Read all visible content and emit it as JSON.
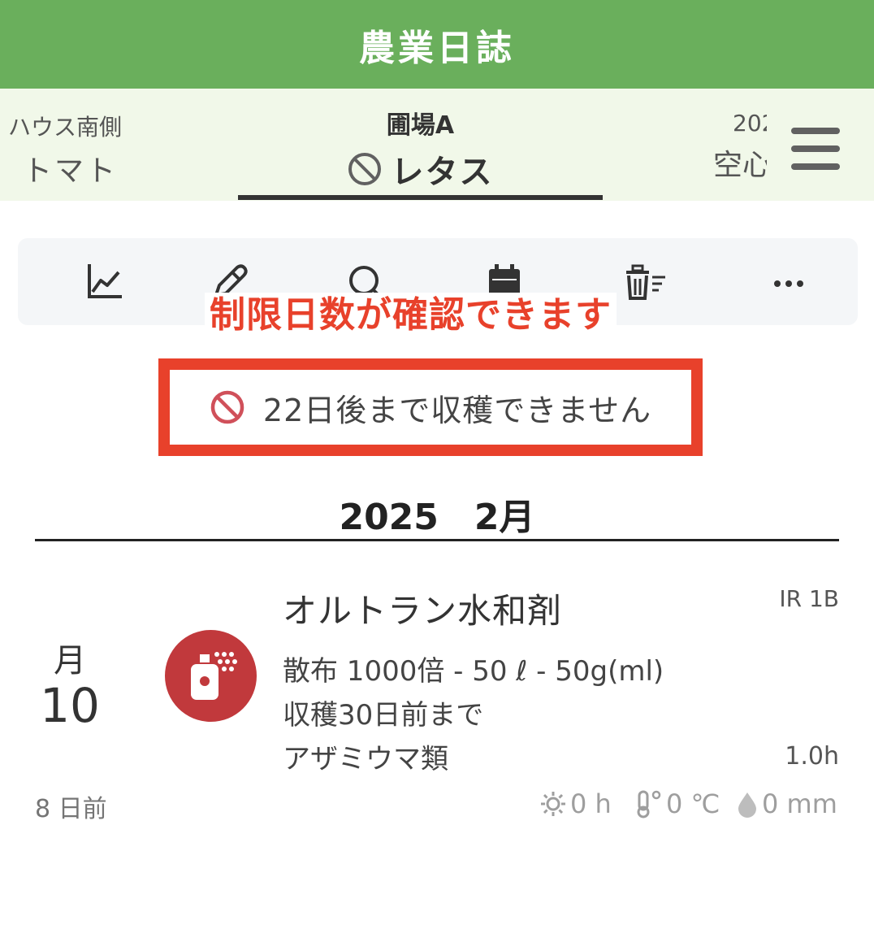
{
  "app": {
    "title": "農業日誌"
  },
  "fields": {
    "left": {
      "location": "ハウス南側",
      "crop": "トマト"
    },
    "center": {
      "location": "圃場A",
      "crop": "レタス"
    },
    "right": {
      "location": "202",
      "crop": "空心"
    }
  },
  "toolbar": {
    "icons": [
      "chart-line-icon",
      "pen-icon",
      "search-icon",
      "calendar-icon",
      "trash-list-icon",
      "more-icon"
    ]
  },
  "callout": {
    "text": "制限日数が確認できます"
  },
  "warning": {
    "text": "22日後まで収穫できません",
    "icon": "prohibited-icon"
  },
  "month": {
    "heading": "2025　2月"
  },
  "entry": {
    "weekday": "月",
    "day": "10",
    "icon": "spray-icon",
    "title": "オルトラン水和剤",
    "code": "IR 1B",
    "detail1": "散布 1000倍 - 50 ℓ  - 50g(ml)",
    "detail2": "収穫30日前まで",
    "detail3": "アザミウマ類",
    "hours": "1.0h",
    "ago": "8 日前",
    "weather": {
      "sun": "0 h",
      "temp": "0 ℃",
      "rain": "0 mm"
    }
  },
  "colors": {
    "header": "#6aaf5c",
    "fieldbar": "#f1f8e9",
    "accent": "#e8412b",
    "spray": "#c1393c",
    "prohibited": "#d0505a"
  }
}
